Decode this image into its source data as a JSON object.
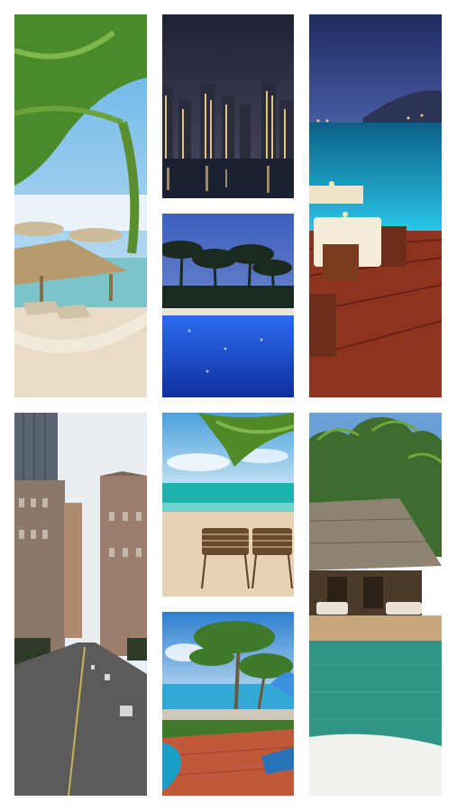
{
  "gallery": {
    "tiles": [
      {
        "name": "beach-hammock-palm-photo",
        "colors": {
          "sky": "#8ec7e8",
          "sand": "#e9dcc6",
          "palm": "#4b8a2a",
          "sea": "#7cc4c9"
        }
      },
      {
        "name": "city-skyline-night-photo",
        "colors": {
          "sky": "#2e2f4a",
          "lights": "#f3d28a",
          "water": "#1b2130"
        }
      },
      {
        "name": "resort-deck-dining-night-photo",
        "colors": {
          "sky": "#2a3c7c",
          "sea": "#1aa3c7",
          "deck": "#9a3a24",
          "tablecloth": "#f6ecd8"
        }
      },
      {
        "name": "resort-pool-palms-night-photo",
        "colors": {
          "sky": "#5b7ac9",
          "pool": "#1d4fd8",
          "palm": "#1b2a1e"
        }
      },
      {
        "name": "city-street-highrise-photo",
        "colors": {
          "sky": "#e9eef3",
          "building": "#9b7f6c",
          "road": "#5d5b5a"
        }
      },
      {
        "name": "beach-lounge-chairs-photo",
        "colors": {
          "sky": "#5aa8dd",
          "sea": "#25b0b0",
          "sand": "#e7d2b4",
          "chair": "#6a4a2c"
        }
      },
      {
        "name": "bungalow-pool-tropical-photo",
        "colors": {
          "sky": "#6aa0d8",
          "jungle": "#3e6b2e",
          "roof": "#8f8472",
          "pool": "#2f9586"
        }
      },
      {
        "name": "tropical-pool-terrace-photo",
        "colors": {
          "sky": "#3e8fd8",
          "palm": "#3f7a2a",
          "terrace": "#c2583a",
          "pool": "#1a9ec8"
        }
      }
    ]
  }
}
